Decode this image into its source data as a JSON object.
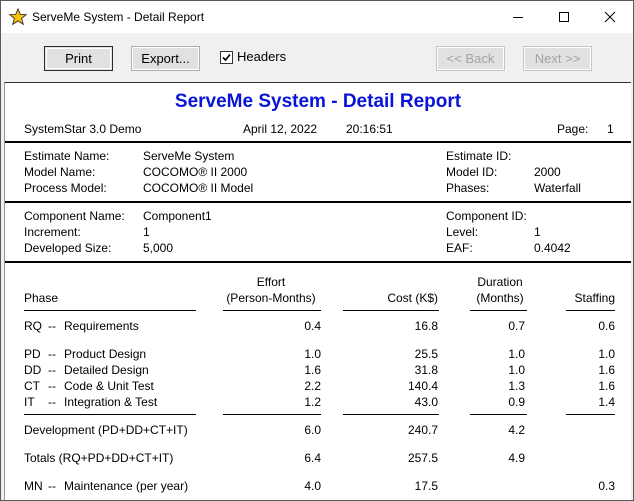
{
  "window": {
    "title": "ServeMe System - Detail Report",
    "icon": "star-icon",
    "controls": [
      "minimize-icon",
      "maximize-icon",
      "close-icon"
    ]
  },
  "toolbar": {
    "print": "Print",
    "export": "Export...",
    "headers_label": "Headers",
    "headers_checked": true,
    "back": "<< Back",
    "next": "Next >>"
  },
  "report": {
    "title": "ServeMe System - Detail Report",
    "product": "SystemStar 3.0 Demo",
    "date": "April 12, 2022",
    "time": "20:16:51",
    "page_label": "Page:",
    "page_number": "1",
    "estimate": {
      "name_label": "Estimate Name:",
      "name": "ServeMe System",
      "model_label": "Model Name:",
      "model": "COCOMO® II 2000",
      "process_label": "Process Model:",
      "process": "COCOMO® II Model",
      "id_label": "Estimate ID:",
      "id": "",
      "model_id_label": "Model ID:",
      "model_id": "2000",
      "phases_label": "Phases:",
      "phases": "Waterfall"
    },
    "component": {
      "name_label": "Component Name:",
      "name": "Component1",
      "increment_label": "Increment:",
      "increment": "1",
      "size_label": "Developed Size:",
      "size": "5,000",
      "id_label": "Component ID:",
      "id": "",
      "level_label": "Level:",
      "level": "1",
      "eaf_label": "EAF:",
      "eaf": "0.4042"
    },
    "columns": {
      "phase": "Phase",
      "effort_1": "Effort",
      "effort_2": "(Person-Months)",
      "cost": "Cost (K$)",
      "duration_1": "Duration",
      "duration_2": "(Months)",
      "staffing": "Staffing"
    },
    "rows": [
      {
        "code": "RQ",
        "sep": "--",
        "name": "Requirements",
        "effort": "0.4",
        "cost": "16.8",
        "duration": "0.7",
        "staffing": "0.6"
      },
      {
        "code": "PD",
        "sep": "--",
        "name": "Product Design",
        "effort": "1.0",
        "cost": "25.5",
        "duration": "1.0",
        "staffing": "1.0"
      },
      {
        "code": "DD",
        "sep": "--",
        "name": "Detailed Design",
        "effort": "1.6",
        "cost": "31.8",
        "duration": "1.0",
        "staffing": "1.6"
      },
      {
        "code": "CT",
        "sep": "--",
        "name": "Code & Unit Test",
        "effort": "2.2",
        "cost": "140.4",
        "duration": "1.3",
        "staffing": "1.6"
      },
      {
        "code": "IT",
        "sep": "--",
        "name": "Integration & Test",
        "effort": "1.2",
        "cost": "43.0",
        "duration": "0.9",
        "staffing": "1.4"
      }
    ],
    "development": {
      "label": "Development (PD+DD+CT+IT)",
      "effort": "6.0",
      "cost": "240.7",
      "duration": "4.2"
    },
    "totals": {
      "label": "Totals (RQ+PD+DD+CT+IT)",
      "effort": "6.4",
      "cost": "257.5",
      "duration": "4.9"
    },
    "maintenance": {
      "code": "MN",
      "sep": "--",
      "name": "Maintenance (per year)",
      "effort": "4.0",
      "cost": "17.5",
      "staffing": "0.3"
    }
  },
  "colors": {
    "title_blue": "#0a14d8",
    "icon_star": "#f4c20d"
  }
}
